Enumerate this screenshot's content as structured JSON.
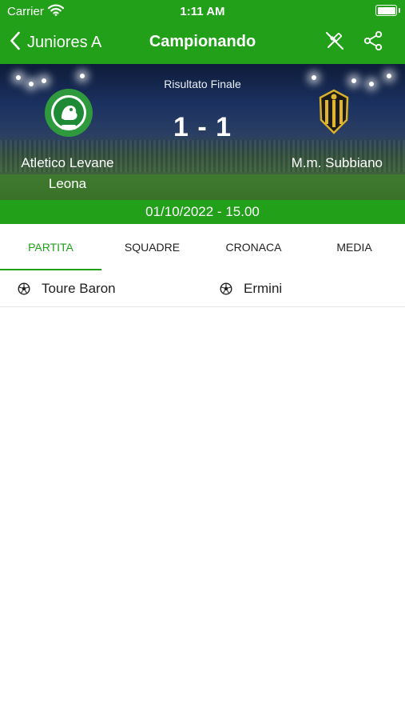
{
  "status_bar": {
    "carrier": "Carrier",
    "time": "1:11 AM"
  },
  "nav": {
    "back_label": "Juniores A",
    "title": "Campionando"
  },
  "match": {
    "result_label": "Risultato Finale",
    "score": "1 - 1",
    "home_team": "Atletico Levane Leona",
    "away_team": "M.m. Subbiano",
    "datetime": "01/10/2022 - 15.00"
  },
  "tabs": [
    {
      "label": "PARTITA",
      "active": true
    },
    {
      "label": "SQUADRE",
      "active": false
    },
    {
      "label": "CRONACA",
      "active": false
    },
    {
      "label": "MEDIA",
      "active": false
    }
  ],
  "scorers": {
    "home": [
      {
        "name": "Toure Baron",
        "icon": "soccer-ball-icon"
      }
    ],
    "away": [
      {
        "name": "Ermini",
        "icon": "soccer-ball-icon"
      }
    ]
  },
  "colors": {
    "brand_green": "#22a01a",
    "text": "#222222",
    "divider": "#e2e2e2"
  },
  "icons": [
    "wifi-icon",
    "battery-icon",
    "back-chevron-icon",
    "whistle-icon",
    "share-icon",
    "soccer-ball-icon"
  ]
}
